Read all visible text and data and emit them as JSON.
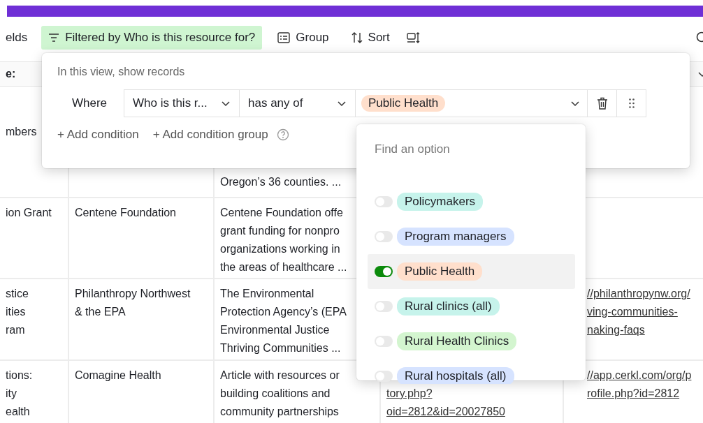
{
  "toolbar": {
    "fields_button": "elds",
    "filter_button": {
      "label": "Filtered by Who is this resource for?",
      "active": true
    },
    "group_button": "Group",
    "sort_button": "Sort"
  },
  "table": {
    "header_cell": "e:",
    "rows": [
      {
        "cells": [
          [
            "mbers"
          ],
          [],
          [
            "Oregon’s 36 counties. ..."
          ],
          [],
          []
        ]
      },
      {
        "cells": [
          [
            "ion Grant"
          ],
          [
            "Centene Foundation"
          ],
          [
            "Centene Foundation offe",
            "grant funding for nonpro",
            "organizations working in",
            "the areas of healthcare ..."
          ],
          [],
          []
        ]
      },
      {
        "cells": [
          [
            "stice",
            "ities",
            "ram"
          ],
          [
            "Philanthropy Northwest",
            "& the EPA"
          ],
          [
            "The Environmental",
            "Protection Agency’s (EPA",
            "Environmental Justice",
            "Thriving Communities ..."
          ],
          [],
          [
            "//philanthropynw.org/",
            "ving-communities-",
            "naking-faqs"
          ]
        ]
      },
      {
        "cells": [
          [
            "tions:",
            "ity",
            "ealth"
          ],
          [
            "Comagine Health"
          ],
          [
            "Article with resources or",
            "building coalitions and",
            "community partnerships"
          ],
          [
            "tory.php?",
            "oid=2812&id=20027850"
          ],
          [
            "//app.cerkl.com/org/p",
            "rofile.php?id=2812"
          ]
        ]
      }
    ]
  },
  "filter_popover": {
    "heading": "In this view, show records",
    "conditions": [
      {
        "label": "Where",
        "field": "Who is this r...",
        "operator": "has any of",
        "values": [
          {
            "label": "Public Health",
            "color": "#ffdfcc"
          }
        ]
      }
    ],
    "add_condition": "+ Add condition",
    "add_condition_group": "+ Add condition group"
  },
  "option_dropdown": {
    "search": {
      "placeholder": "Find an option"
    },
    "options": [
      {
        "label": "Policymakers",
        "color": "#c6f3eb",
        "selected": false
      },
      {
        "label": "Program managers",
        "color": "#d6e3ff",
        "selected": false
      },
      {
        "label": "Public Health",
        "color": "#ffdfcc",
        "selected": true
      },
      {
        "label": "Rural clinics (all)",
        "color": "#c6f3eb",
        "selected": false
      },
      {
        "label": "Rural Health Clinics",
        "color": "#d3f5cf",
        "selected": false
      },
      {
        "label": "Rural hospitals (all)",
        "color": "#d6e3ff",
        "selected": false
      }
    ]
  }
}
